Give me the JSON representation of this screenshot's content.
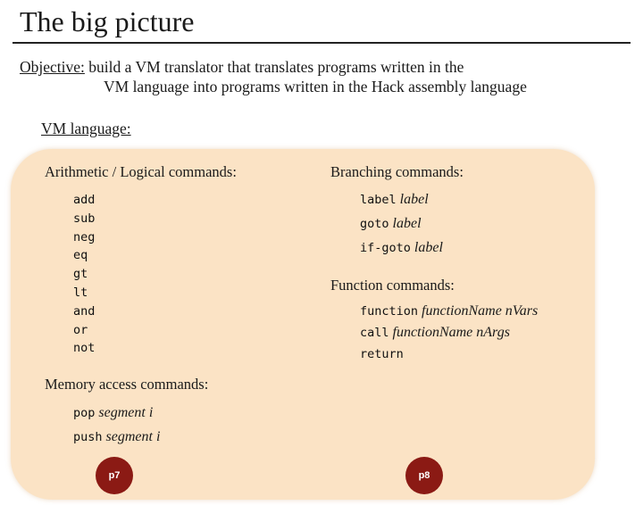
{
  "slide": {
    "title": "The big picture",
    "objective": {
      "label": "Objective:",
      "line1": "build a VM translator that translates programs written in the",
      "line2": "VM language into programs written in the Hack assembly language"
    },
    "vm_heading": "VM language:"
  },
  "arithmetic": {
    "title": "Arithmetic / Logical commands:",
    "commands": [
      "add",
      "sub",
      "neg",
      "eq",
      "gt",
      "lt",
      "and",
      "or",
      "not"
    ]
  },
  "memory": {
    "title": "Memory access commands:",
    "commands": [
      {
        "cmd": "pop",
        "arg": "segment i"
      },
      {
        "cmd": "push",
        "arg": "segment i"
      }
    ]
  },
  "branching": {
    "title": "Branching commands:",
    "commands": [
      {
        "cmd": "label",
        "arg": "label"
      },
      {
        "cmd": "goto",
        "arg": "label"
      },
      {
        "cmd": "if-goto",
        "arg": "label"
      }
    ]
  },
  "function": {
    "title": "Function commands:",
    "commands": [
      {
        "cmd": "function",
        "arg": "functionName nVars"
      },
      {
        "cmd": "call",
        "arg": "functionName nArgs"
      },
      {
        "cmd": "return",
        "arg": ""
      }
    ]
  },
  "badges": {
    "p7": "p7",
    "p8": "p8"
  },
  "colors": {
    "panel": "#fbe3c5",
    "badge": "#8b1a14"
  }
}
